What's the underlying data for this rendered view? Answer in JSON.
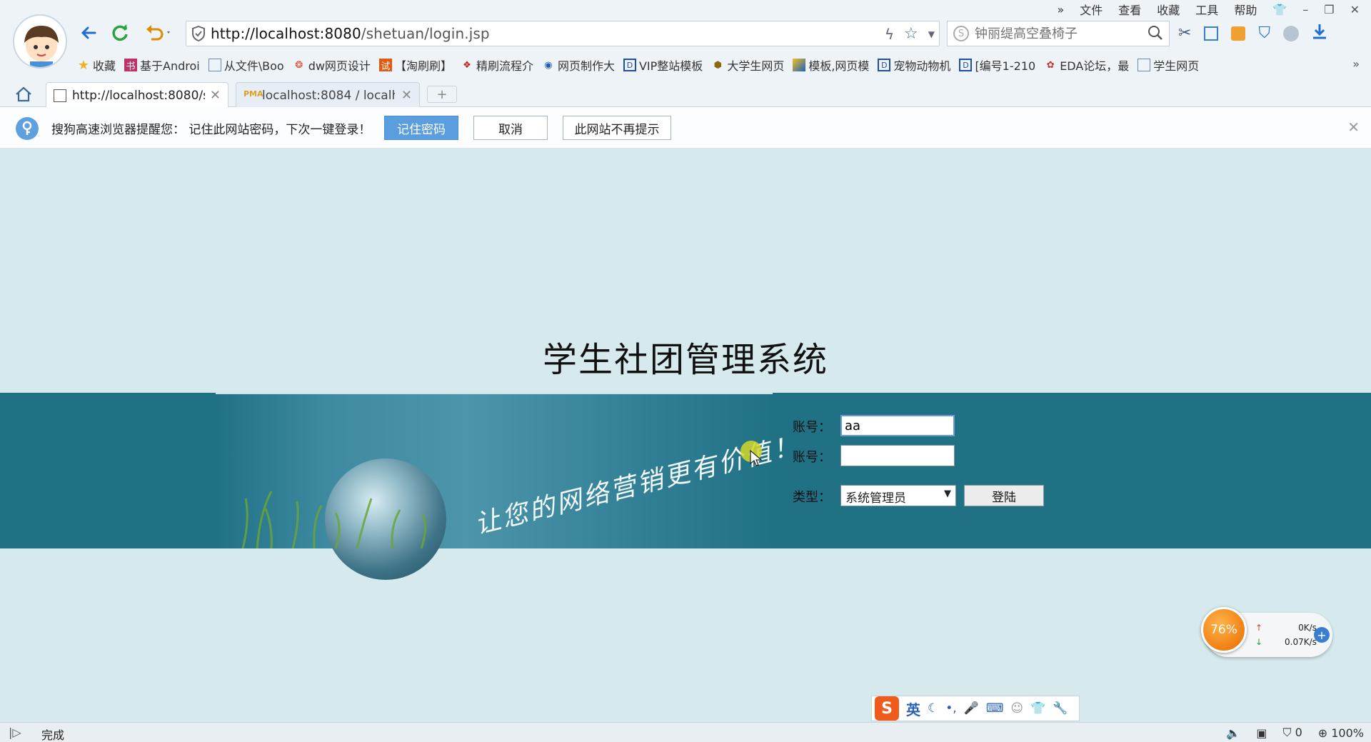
{
  "menu": {
    "file": "文件",
    "view": "查看",
    "favorites": "收藏",
    "tools": "工具",
    "help": "帮助"
  },
  "url": {
    "host": "http://localhost:8080",
    "path": "/shetuan/login.jsp"
  },
  "search": {
    "placeholder": "钟丽缇高空叠椅子"
  },
  "bookmarks": [
    {
      "label": "收藏"
    },
    {
      "label": "基于Androi"
    },
    {
      "label": "从文件\\Boo"
    },
    {
      "label": "dw网页设计"
    },
    {
      "label": "【淘刷刷】"
    },
    {
      "label": "精刷流程介"
    },
    {
      "label": "网页制作大"
    },
    {
      "label": "VIP整站模板"
    },
    {
      "label": "大学生网页"
    },
    {
      "label": "模板,网页模"
    },
    {
      "label": "宠物动物机"
    },
    {
      "label": "[编号1-210"
    },
    {
      "label": "EDA论坛，最"
    },
    {
      "label": "学生网页"
    }
  ],
  "tabs": [
    {
      "label": "http://localhost:8080/s"
    },
    {
      "label": "localhost:8084 / localh"
    }
  ],
  "notification": {
    "text": "搜狗高速浏览器提醒您： 记住此网站密码，下次一键登录！",
    "remember": "记住密码",
    "cancel": "取消",
    "never": "此网站不再提示"
  },
  "page": {
    "title": "学生社团管理系统",
    "slogan": "让您的网络营销更有价值！",
    "account_label": "账号：",
    "account_value": "aa",
    "password_label": "账号：",
    "type_label": "类型：",
    "type_selected": "系统管理员",
    "login_button": "登陆"
  },
  "speed_widget": {
    "percent": "76%",
    "upload": "0K/s",
    "download": "0.07K/s"
  },
  "ime": {
    "mode": "英"
  },
  "status": {
    "text": "完成",
    "blocked": "0",
    "zoom": "100%"
  },
  "colors": {
    "banner": "#217185",
    "page_bg": "#d6eaee",
    "primary_button": "#5a9ee0"
  }
}
